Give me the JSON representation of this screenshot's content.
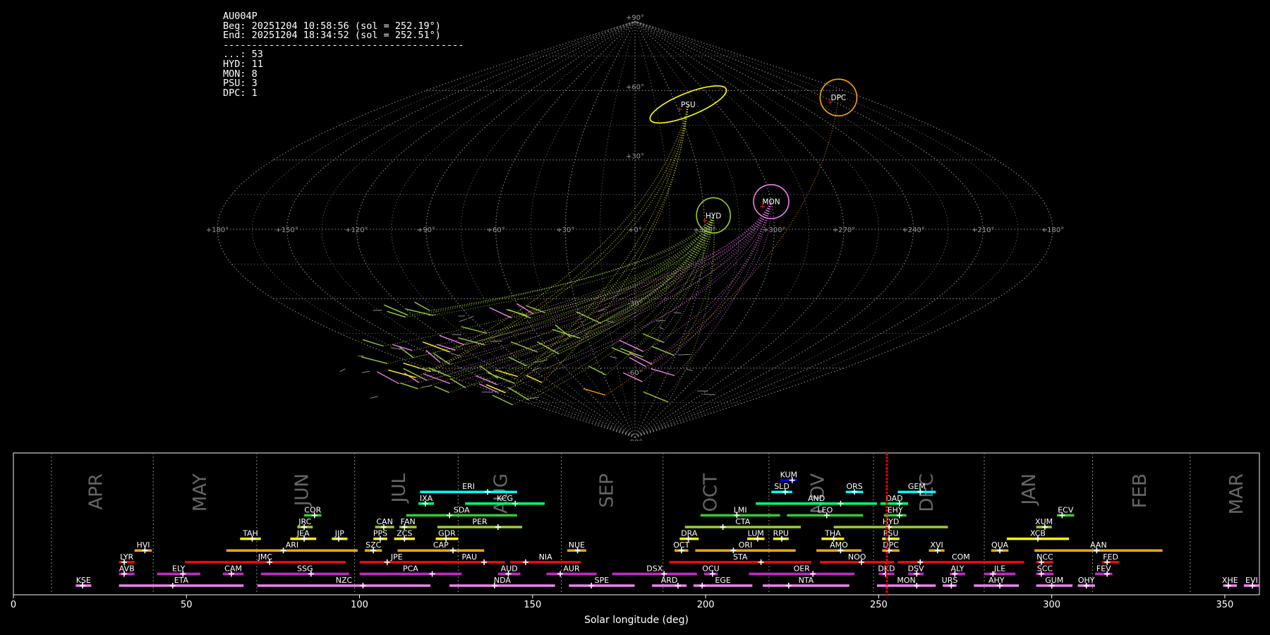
{
  "info": {
    "station": "AU004P",
    "begin": "Beg: 20251204 10:58:56 (sol = 252.19°)",
    "end": "End: 20251204 18:34:52 (sol = 252.51°)",
    "separator": "------------------------------------------",
    "counts": [
      {
        "code": "...",
        "n": 53
      },
      {
        "code": "HYD",
        "n": 11
      },
      {
        "code": "MON",
        "n": 8
      },
      {
        "code": "PSU",
        "n": 3
      },
      {
        "code": "DPC",
        "n": 1
      }
    ]
  },
  "chart_data": [
    {
      "type": "scatter",
      "projection": "sinusoidal",
      "grid": true,
      "lat_tick_labels": [
        "+90°",
        "+60°",
        "+30°",
        "0°",
        "-30°",
        "-60°",
        "-90°"
      ],
      "lon_tick_labels": [
        "+180°",
        "+150°",
        "+120°",
        "+90°",
        "+60°",
        "+30°",
        "+0°",
        "+330°",
        "+300°",
        "+270°",
        "+240°",
        "+210°",
        "+180°"
      ],
      "radiants": [
        {
          "code": "PSU",
          "lon": 141,
          "lat": 54,
          "color": "#ffff00"
        },
        {
          "code": "DPC",
          "lon": 19,
          "lat": 57,
          "color": "#ffa500"
        },
        {
          "code": "HYD",
          "lon": 146,
          "lat": 6,
          "color": "#9acd32"
        },
        {
          "code": "MON",
          "lon": 120,
          "lat": 12,
          "color": "#ee82ee"
        }
      ]
    },
    {
      "type": "timeline",
      "xlabel": "Solar longitude (deg)",
      "xlim": [
        0,
        360
      ],
      "xticks": [
        0,
        50,
        100,
        150,
        200,
        250,
        300,
        350
      ],
      "current_sol": [
        252.19,
        252.51
      ],
      "months": [
        {
          "name": "APR",
          "start": 11,
          "label": 24
        },
        {
          "name": "MAY",
          "start": 40.4,
          "label": 54
        },
        {
          "name": "JUN",
          "start": 70.3,
          "label": 83.5
        },
        {
          "name": "JUL",
          "start": 98.6,
          "label": 111.5
        },
        {
          "name": "AUG",
          "start": 128.5,
          "label": 141
        },
        {
          "name": "SEP",
          "start": 158.3,
          "label": 171.5
        },
        {
          "name": "OCT",
          "start": 187.7,
          "label": 201.5
        },
        {
          "name": "NOV",
          "start": 218.3,
          "label": 232.5
        },
        {
          "name": "DEC",
          "start": 248.5,
          "label": 264
        },
        {
          "name": "JAN",
          "start": 280.5,
          "label": 293.5
        },
        {
          "name": "FEB",
          "start": 311.8,
          "label": 325.5
        },
        {
          "name": "MAR",
          "start": 340,
          "label": 353.5
        }
      ],
      "showers": [
        {
          "code": "KUM",
          "start": 221.5,
          "end": 226.5,
          "peak": 225,
          "row": 9,
          "color": "#0000ff"
        },
        {
          "code": "ERI",
          "start": 117.5,
          "end": 145.5,
          "peak": 137,
          "row": 8,
          "color": "#00ffff"
        },
        {
          "code": "SLD",
          "start": 219,
          "end": 225,
          "peak": 223,
          "row": 8,
          "color": "#00ffff"
        },
        {
          "code": "ORS",
          "start": 240.5,
          "end": 245.5,
          "peak": 243,
          "row": 8,
          "color": "#00ffff"
        },
        {
          "code": "GEM",
          "start": 255.5,
          "end": 266.5,
          "peak": 262,
          "row": 8,
          "color": "#00ffff"
        },
        {
          "code": "IXA",
          "start": 117,
          "end": 121.5,
          "peak": 119,
          "row": 7,
          "color": "#00ff7f"
        },
        {
          "code": "KCG",
          "start": 130.5,
          "end": 153.5,
          "peak": 145,
          "row": 7,
          "color": "#00ff7f"
        },
        {
          "code": "AND",
          "start": 214.5,
          "end": 249.5,
          "peak": 239,
          "row": 7,
          "color": "#00ff7f"
        },
        {
          "code": "DAD",
          "start": 250.5,
          "end": 258.5,
          "peak": 256,
          "row": 7,
          "color": "#00ff7f"
        },
        {
          "code": "COR",
          "start": 84,
          "end": 89,
          "peak": 87,
          "row": 6,
          "color": "#32cd32"
        },
        {
          "code": "SDA",
          "start": 113.5,
          "end": 145.5,
          "peak": 126,
          "row": 6,
          "color": "#32cd32"
        },
        {
          "code": "LMI",
          "start": 198.5,
          "end": 221.5,
          "peak": 209,
          "row": 6,
          "color": "#32cd32"
        },
        {
          "code": "LEO",
          "start": 223.5,
          "end": 245.5,
          "peak": 235,
          "row": 6,
          "color": "#32cd32"
        },
        {
          "code": "EHY",
          "start": 251.5,
          "end": 258,
          "peak": 256,
          "row": 6,
          "color": "#32cd32"
        },
        {
          "code": "ECV",
          "start": 301.5,
          "end": 306.5,
          "peak": 303,
          "row": 6,
          "color": "#32cd32"
        },
        {
          "code": "JRC",
          "start": 82,
          "end": 86.5,
          "peak": 84,
          "row": 5,
          "color": "#9acd32"
        },
        {
          "code": "CAN",
          "start": 104.5,
          "end": 110,
          "peak": 107,
          "row": 5,
          "color": "#9acd32"
        },
        {
          "code": "FAN",
          "start": 111.5,
          "end": 116.5,
          "peak": 113,
          "row": 5,
          "color": "#9acd32"
        },
        {
          "code": "PER",
          "start": 122.5,
          "end": 147,
          "peak": 140,
          "row": 5,
          "color": "#9acd32"
        },
        {
          "code": "CTA",
          "start": 194,
          "end": 227.5,
          "peak": 205,
          "row": 5,
          "color": "#9acd32"
        },
        {
          "code": "HYD",
          "start": 237,
          "end": 270,
          "peak": 253,
          "row": 5,
          "color": "#9acd32"
        },
        {
          "code": "XUM",
          "start": 295.5,
          "end": 300,
          "peak": 298,
          "row": 5,
          "color": "#9acd32"
        },
        {
          "code": "TAH",
          "start": 65.5,
          "end": 71.5,
          "peak": 69,
          "row": 4,
          "color": "#ffff00"
        },
        {
          "code": "JEA",
          "start": 80,
          "end": 87.5,
          "peak": 84,
          "row": 4,
          "color": "#ffff00"
        },
        {
          "code": "JIP",
          "start": 92,
          "end": 96.5,
          "peak": 94,
          "row": 4,
          "color": "#ffff00"
        },
        {
          "code": "PPS",
          "start": 104,
          "end": 108,
          "peak": 106,
          "row": 4,
          "color": "#ffff00"
        },
        {
          "code": "ZCS",
          "start": 110,
          "end": 116,
          "peak": 113,
          "row": 4,
          "color": "#ffff00"
        },
        {
          "code": "GDR",
          "start": 122,
          "end": 128.5,
          "peak": 125,
          "row": 4,
          "color": "#ffff00"
        },
        {
          "code": "DRA",
          "start": 192.5,
          "end": 198,
          "peak": 195,
          "row": 4,
          "color": "#ffff00"
        },
        {
          "code": "LUM",
          "start": 212,
          "end": 217,
          "peak": 215,
          "row": 4,
          "color": "#ffff00"
        },
        {
          "code": "RPU",
          "start": 219.5,
          "end": 224,
          "peak": 222,
          "row": 4,
          "color": "#ffff00"
        },
        {
          "code": "THA",
          "start": 233.5,
          "end": 240,
          "peak": 237,
          "row": 4,
          "color": "#ffff00"
        },
        {
          "code": "PSU",
          "start": 251,
          "end": 256,
          "peak": 253,
          "row": 4,
          "color": "#ffff00"
        },
        {
          "code": "XCB",
          "start": 287,
          "end": 305,
          "peak": 296,
          "row": 4,
          "color": "#ffff00"
        },
        {
          "code": "HVI",
          "start": 35,
          "end": 40,
          "peak": 38,
          "row": 3,
          "color": "#ffa500"
        },
        {
          "code": "ARI",
          "start": 61.5,
          "end": 99.5,
          "peak": 78,
          "row": 3,
          "color": "#ffa500"
        },
        {
          "code": "SZC",
          "start": 101.5,
          "end": 106.5,
          "peak": 104,
          "row": 3,
          "color": "#ffa500"
        },
        {
          "code": "CAP",
          "start": 111,
          "end": 136,
          "peak": 127,
          "row": 3,
          "color": "#ffa500"
        },
        {
          "code": "NUE",
          "start": 160,
          "end": 165.5,
          "peak": 163,
          "row": 3,
          "color": "#ffa500"
        },
        {
          "code": "OCT",
          "start": 191,
          "end": 195,
          "peak": 193,
          "row": 3,
          "color": "#ffa500"
        },
        {
          "code": "ORI",
          "start": 197,
          "end": 226,
          "peak": 208,
          "row": 3,
          "color": "#ffa500"
        },
        {
          "code": "AMO",
          "start": 232,
          "end": 245,
          "peak": 239,
          "row": 3,
          "color": "#ffa500"
        },
        {
          "code": "DPC",
          "start": 251,
          "end": 256,
          "peak": 253,
          "row": 3,
          "color": "#ffa500"
        },
        {
          "code": "XVI",
          "start": 264.5,
          "end": 269,
          "peak": 267,
          "row": 3,
          "color": "#ffa500"
        },
        {
          "code": "QUA",
          "start": 282.5,
          "end": 287.5,
          "peak": 285,
          "row": 3,
          "color": "#ffa500"
        },
        {
          "code": "AAN",
          "start": 295,
          "end": 332,
          "peak": 313,
          "row": 3,
          "color": "#ffa500"
        },
        {
          "code": "LYR",
          "start": 30.5,
          "end": 35,
          "peak": 32,
          "row": 2,
          "color": "#ff0000"
        },
        {
          "code": "JMC",
          "start": 49.5,
          "end": 96,
          "peak": 74,
          "row": 2,
          "color": "#ff0000"
        },
        {
          "code": "JPE",
          "start": 100,
          "end": 121.5,
          "peak": 108,
          "row": 2,
          "color": "#ff0000"
        },
        {
          "code": "PAU",
          "start": 121.5,
          "end": 142,
          "peak": 136,
          "row": 2,
          "color": "#ff0000"
        },
        {
          "code": "NIA",
          "start": 143.5,
          "end": 164,
          "peak": 148,
          "row": 2,
          "color": "#ff0000"
        },
        {
          "code": "STA",
          "start": 189.5,
          "end": 230.5,
          "peak": 216,
          "row": 2,
          "color": "#ff0000"
        },
        {
          "code": "NOO",
          "start": 233,
          "end": 254.5,
          "peak": 245,
          "row": 2,
          "color": "#ff0000"
        },
        {
          "code": "COM",
          "start": 255.5,
          "end": 292,
          "peak": 262,
          "row": 2,
          "color": "#ff0000"
        },
        {
          "code": "NCC",
          "start": 295.5,
          "end": 300.5,
          "peak": 297,
          "row": 2,
          "color": "#ff0000"
        },
        {
          "code": "FED",
          "start": 314.5,
          "end": 319.5,
          "peak": 316,
          "row": 2,
          "color": "#ff0000"
        },
        {
          "code": "AVB",
          "start": 30.5,
          "end": 35,
          "peak": 32,
          "row": 1,
          "color": "#cc22cc"
        },
        {
          "code": "ELY",
          "start": 41.5,
          "end": 54,
          "peak": 49,
          "row": 1,
          "color": "#cc22cc"
        },
        {
          "code": "CAM",
          "start": 60.5,
          "end": 66.5,
          "peak": 63,
          "row": 1,
          "color": "#cc22cc"
        },
        {
          "code": "SSG",
          "start": 71.5,
          "end": 97,
          "peak": 86,
          "row": 1,
          "color": "#cc22cc"
        },
        {
          "code": "PCA",
          "start": 100,
          "end": 129.5,
          "peak": 121,
          "row": 1,
          "color": "#cc22cc"
        },
        {
          "code": "AUD",
          "start": 140,
          "end": 146.5,
          "peak": 143,
          "row": 1,
          "color": "#cc22cc"
        },
        {
          "code": "AUR",
          "start": 154,
          "end": 168.5,
          "peak": 158,
          "row": 1,
          "color": "#cc22cc"
        },
        {
          "code": "DSX",
          "start": 173,
          "end": 197.5,
          "peak": 188,
          "row": 1,
          "color": "#cc22cc"
        },
        {
          "code": "OCU",
          "start": 199.5,
          "end": 203.5,
          "peak": 202,
          "row": 1,
          "color": "#cc22cc"
        },
        {
          "code": "OER",
          "start": 212.5,
          "end": 243,
          "peak": 231,
          "row": 1,
          "color": "#cc22cc"
        },
        {
          "code": "DKD",
          "start": 250,
          "end": 254.5,
          "peak": 252,
          "row": 1,
          "color": "#cc22cc"
        },
        {
          "code": "DSV",
          "start": 258.5,
          "end": 263,
          "peak": 261,
          "row": 1,
          "color": "#cc22cc"
        },
        {
          "code": "ALY",
          "start": 270.5,
          "end": 275,
          "peak": 272,
          "row": 1,
          "color": "#cc22cc"
        },
        {
          "code": "JLE",
          "start": 280.5,
          "end": 289.5,
          "peak": 283,
          "row": 1,
          "color": "#cc22cc"
        },
        {
          "code": "SCC",
          "start": 295.5,
          "end": 300.5,
          "peak": 297,
          "row": 1,
          "color": "#cc22cc"
        },
        {
          "code": "FEV",
          "start": 312.5,
          "end": 317.5,
          "peak": 316,
          "row": 1,
          "color": "#cc22cc"
        },
        {
          "code": "KSE",
          "start": 18,
          "end": 22.5,
          "peak": 20,
          "row": 0,
          "color": "#ee82ee"
        },
        {
          "code": "ETA",
          "start": 30.5,
          "end": 66.5,
          "peak": 46,
          "row": 0,
          "color": "#ee82ee"
        },
        {
          "code": "NZC",
          "start": 70.5,
          "end": 120.5,
          "peak": 101,
          "row": 0,
          "color": "#ee82ee"
        },
        {
          "code": "NDA",
          "start": 126,
          "end": 156.5,
          "peak": 139,
          "row": 0,
          "color": "#ee82ee"
        },
        {
          "code": "SPE",
          "start": 160.5,
          "end": 179.5,
          "peak": 167,
          "row": 0,
          "color": "#ee82ee"
        },
        {
          "code": "ARD",
          "start": 184.5,
          "end": 194.5,
          "peak": 192,
          "row": 0,
          "color": "#ee82ee"
        },
        {
          "code": "EGE",
          "start": 196.5,
          "end": 213.5,
          "peak": 199,
          "row": 0,
          "color": "#ee82ee"
        },
        {
          "code": "NTA",
          "start": 216.5,
          "end": 241.5,
          "peak": 224,
          "row": 0,
          "color": "#ee82ee"
        },
        {
          "code": "MON",
          "start": 249.5,
          "end": 266.5,
          "peak": 261,
          "row": 0,
          "color": "#ee82ee"
        },
        {
          "code": "URS",
          "start": 268.5,
          "end": 272.5,
          "peak": 271,
          "row": 0,
          "color": "#ee82ee"
        },
        {
          "code": "AHY",
          "start": 277.5,
          "end": 290.5,
          "peak": 285,
          "row": 0,
          "color": "#ee82ee"
        },
        {
          "code": "GUM",
          "start": 295.5,
          "end": 306,
          "peak": 300,
          "row": 0,
          "color": "#ee82ee"
        },
        {
          "code": "OHY",
          "start": 307.5,
          "end": 312.5,
          "peak": 310,
          "row": 0,
          "color": "#ee82ee"
        },
        {
          "code": "XHE",
          "start": 349.5,
          "end": 353.5,
          "peak": 351,
          "row": 0,
          "color": "#ee82ee"
        },
        {
          "code": "EVI",
          "start": 355.5,
          "end": 360,
          "peak": 358,
          "row": 0,
          "color": "#ee82ee"
        }
      ]
    }
  ]
}
